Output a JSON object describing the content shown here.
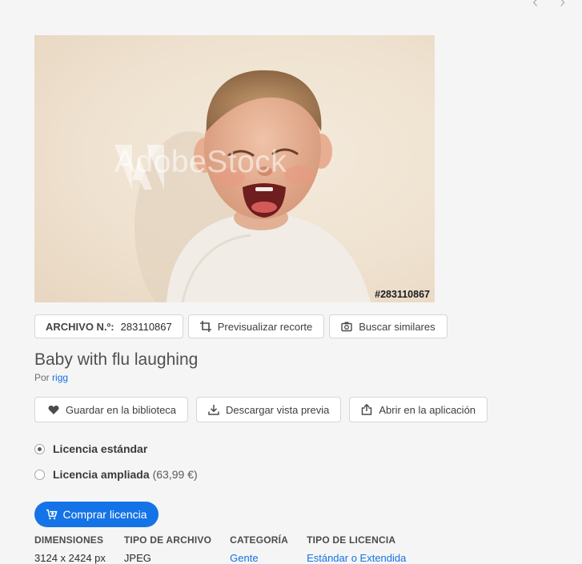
{
  "nav": {
    "prev_icon": "chevron-left-icon",
    "next_icon": "chevron-right-icon"
  },
  "image": {
    "watermark": "AdobeStock",
    "id_label": "#283110867"
  },
  "toolbar": {
    "archive_label": "ARCHIVO N.º:",
    "archive_value": "283110867",
    "crop_preview": "Previsualizar recorte",
    "find_similar": "Buscar similares"
  },
  "asset": {
    "title": "Baby with flu laughing",
    "by_prefix": "Por",
    "author": "rigg"
  },
  "actions": {
    "save_library": "Guardar en la biblioteca",
    "download_preview": "Descargar vista previa",
    "open_in_app": "Abrir en la aplicación"
  },
  "licenses": [
    {
      "name": "Licencia estándar",
      "price": "",
      "selected": true
    },
    {
      "name": "Licencia ampliada",
      "price": "(63,99 €)",
      "selected": false
    }
  ],
  "buy_label": "Comprar licencia",
  "details": [
    {
      "head": "DIMENSIONES",
      "value": "3124 x 2424 px"
    },
    {
      "head": "TIPO DE ARCHIVO",
      "value": "JPEG"
    },
    {
      "head": "CATEGORÍA",
      "value": "Gente"
    },
    {
      "head": "TIPO DE LICENCIA",
      "value": "Estándar o Extendida"
    }
  ],
  "colors": {
    "accent": "#1473e6",
    "background": "#f5f5f5"
  }
}
